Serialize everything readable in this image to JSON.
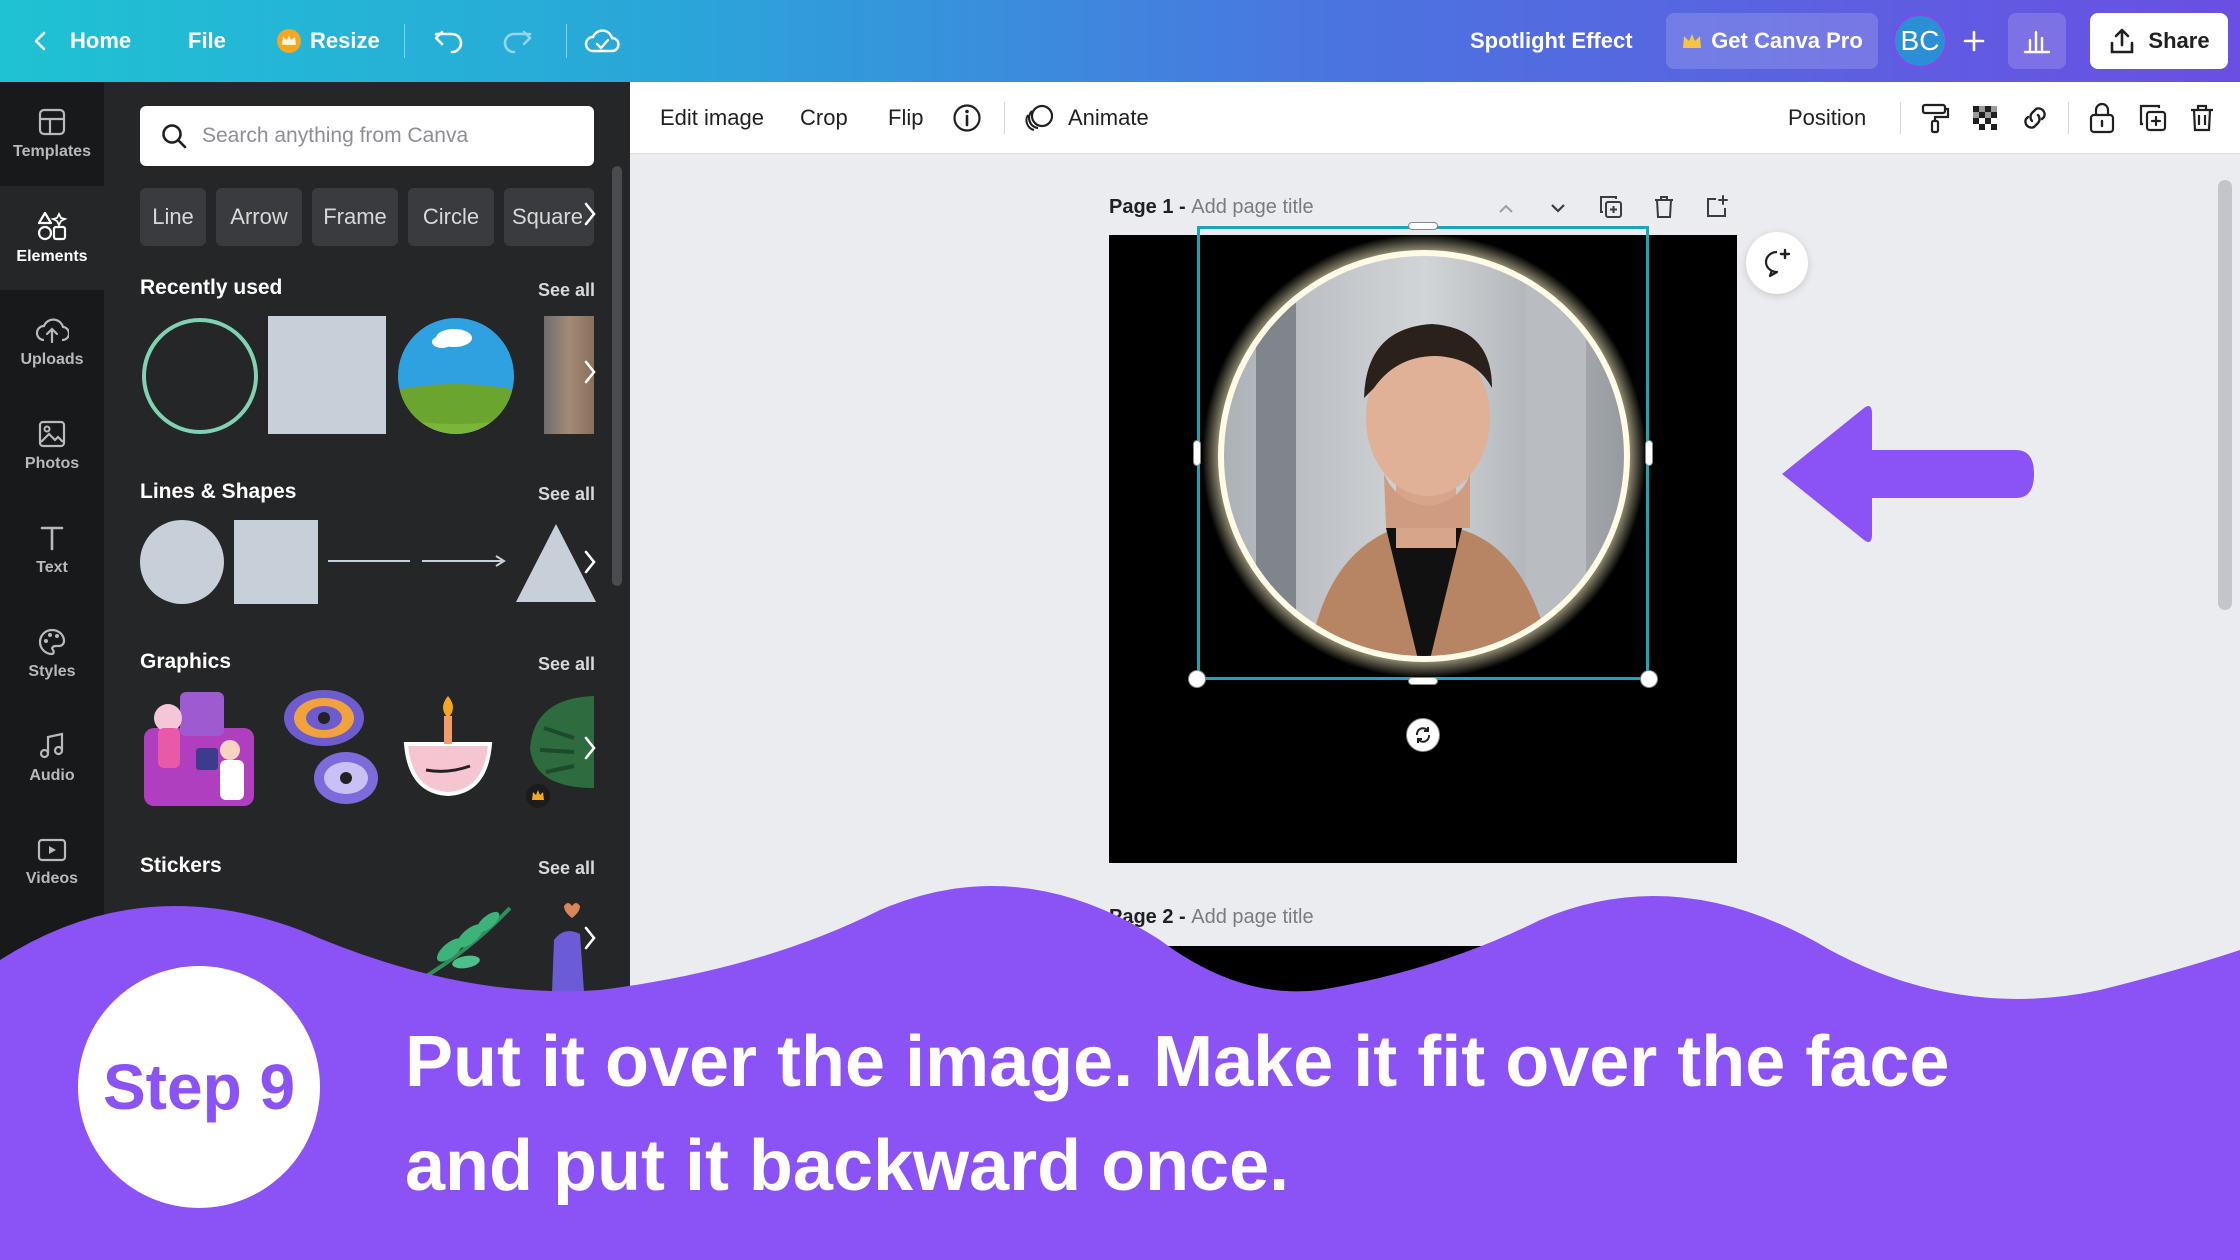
{
  "colors": {
    "accent_purple": "#8b52f6",
    "selection_teal": "#1aa6b2",
    "crown_gold": "#f5a623"
  },
  "topbar": {
    "home_label": "Home",
    "file_label": "File",
    "resize_label": "Resize",
    "project_title": "Spotlight Effect",
    "pro_label": "Get Canva Pro",
    "avatar_initials": "BC",
    "share_label": "Share"
  },
  "rail": {
    "items": [
      {
        "label": "Templates",
        "icon": "templates-icon"
      },
      {
        "label": "Elements",
        "icon": "elements-icon"
      },
      {
        "label": "Uploads",
        "icon": "uploads-icon"
      },
      {
        "label": "Photos",
        "icon": "photos-icon"
      },
      {
        "label": "Text",
        "icon": "text-icon"
      },
      {
        "label": "Styles",
        "icon": "styles-icon"
      },
      {
        "label": "Audio",
        "icon": "audio-icon"
      },
      {
        "label": "Videos",
        "icon": "videos-icon"
      }
    ]
  },
  "panel": {
    "search_placeholder": "Search anything from Canva",
    "chips": [
      "Line",
      "Arrow",
      "Frame",
      "Circle",
      "Square"
    ],
    "sections": {
      "recent": {
        "title": "Recently used",
        "see_all": "See all"
      },
      "shapes": {
        "title": "Lines & Shapes",
        "see_all": "See all"
      },
      "graphics": {
        "title": "Graphics",
        "see_all": "See all"
      },
      "stickers": {
        "title": "Stickers",
        "see_all": "See all"
      }
    }
  },
  "toolbar": {
    "edit_image": "Edit image",
    "crop": "Crop",
    "flip": "Flip",
    "animate": "Animate",
    "position": "Position"
  },
  "canvas": {
    "page1_prefix": "Page 1 -",
    "page1_title_placeholder": "Add page title",
    "page2_prefix": "Page 2 -",
    "page2_title_placeholder": "Add page title"
  },
  "overlay": {
    "step_label": "Step 9",
    "caption_line1": "Put it over the image. Make it fit over the face",
    "caption_line2": "and put it backward once."
  }
}
